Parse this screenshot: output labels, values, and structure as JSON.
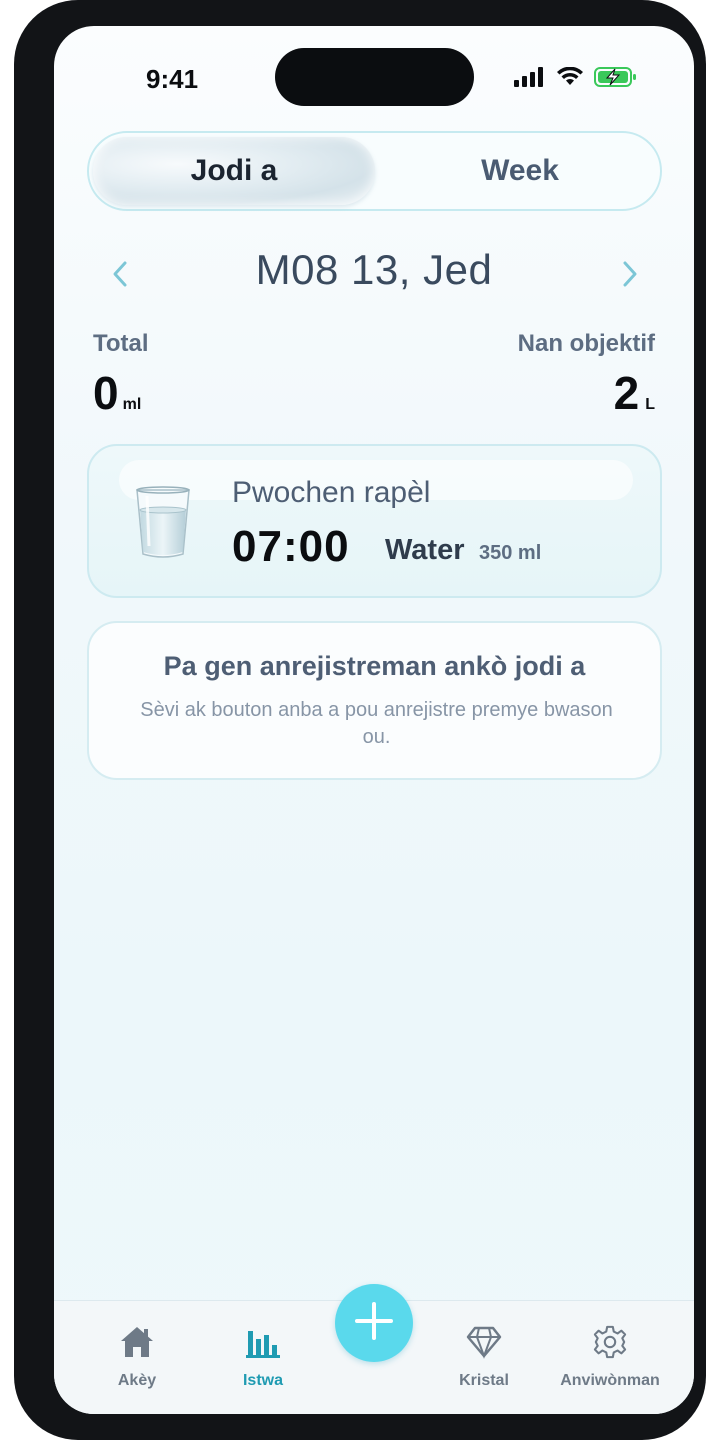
{
  "status_bar": {
    "time": "9:41",
    "icons": [
      "signal-icon",
      "wifi-icon",
      "battery-charging-icon"
    ]
  },
  "segment": {
    "active_label": "Jodi a",
    "inactive_label": "Week"
  },
  "date_nav": {
    "label": "M08 13, Jed",
    "prev_icon": "chevron-left-icon",
    "next_icon": "chevron-right-icon"
  },
  "summary": {
    "total_label": "Total",
    "total_value": "0",
    "total_unit": "ml",
    "goal_label": "Nan objektif",
    "goal_value": "2",
    "goal_unit": "L"
  },
  "reminder": {
    "title": "Pwochen rapèl",
    "time": "07:00",
    "drink": "Water",
    "amount": "350 ml",
    "icon": "water-glass-icon"
  },
  "empty_state": {
    "title": "Pa gen anrejistreman ankò jodi a",
    "description": "Sèvi ak bouton anba a pou anrejistre premye bwason ou."
  },
  "tabbar": {
    "home": "Akèy",
    "history": "Istwa",
    "crystal": "Kristal",
    "settings": "Anviwònman",
    "active": "history"
  },
  "colors": {
    "accent": "#1f9bb2",
    "fab": "#5ad9ec",
    "chevron": "#7cc6d6"
  }
}
